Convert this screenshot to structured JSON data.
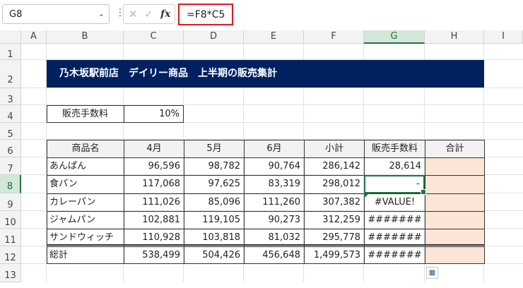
{
  "formula_bar": {
    "name_box": "G8",
    "formula": "=F8*C5"
  },
  "columns": [
    "A",
    "B",
    "C",
    "D",
    "E",
    "F",
    "G",
    "H",
    "I"
  ],
  "rows": [
    "1",
    "2",
    "3",
    "4",
    "5",
    "6",
    "7",
    "8",
    "9",
    "10",
    "11",
    "12",
    "13"
  ],
  "selected_cell": {
    "column": "G",
    "row": "8"
  },
  "sheet": {
    "title": "乃木坂駅前店　デイリー商品　上半期の販売集計",
    "fee_label": "販売手数料",
    "fee_value": "10%",
    "headers": [
      "商品名",
      "4月",
      "5月",
      "6月",
      "小計",
      "販売手数料",
      "合計"
    ],
    "data_rows": [
      {
        "name": "あんぱん",
        "apr": "96,596",
        "may": "98,782",
        "jun": "90,764",
        "subtotal": "286,142",
        "fee": "28,614",
        "total": ""
      },
      {
        "name": "食パン",
        "apr": "117,068",
        "may": "97,625",
        "jun": "83,319",
        "subtotal": "298,012",
        "fee": "-",
        "total": ""
      },
      {
        "name": "カレーパン",
        "apr": "111,026",
        "may": "85,096",
        "jun": "111,260",
        "subtotal": "307,382",
        "fee": "#VALUE!",
        "total": ""
      },
      {
        "name": "ジャムパン",
        "apr": "102,881",
        "may": "119,105",
        "jun": "90,273",
        "subtotal": "312,259",
        "fee": "#######",
        "total": ""
      },
      {
        "name": "サンドウィッチ",
        "apr": "110,928",
        "may": "103,818",
        "jun": "81,032",
        "subtotal": "295,778",
        "fee": "#######",
        "total": ""
      }
    ],
    "total_row": {
      "name": "総計",
      "apr": "538,499",
      "may": "504,426",
      "jun": "456,648",
      "subtotal": "1,499,573",
      "fee": "#######",
      "total": ""
    }
  },
  "colors": {
    "title_bg": "#002060",
    "selection": "#217346",
    "total_fill": "#fce4d6",
    "formula_highlight": "#e0191e"
  },
  "icons": {
    "name_box_dropdown": "chevron-down-icon",
    "cancel": "x-icon",
    "enter": "check-icon",
    "function": "fx-icon",
    "quick_analysis": "quick-analysis-icon"
  }
}
